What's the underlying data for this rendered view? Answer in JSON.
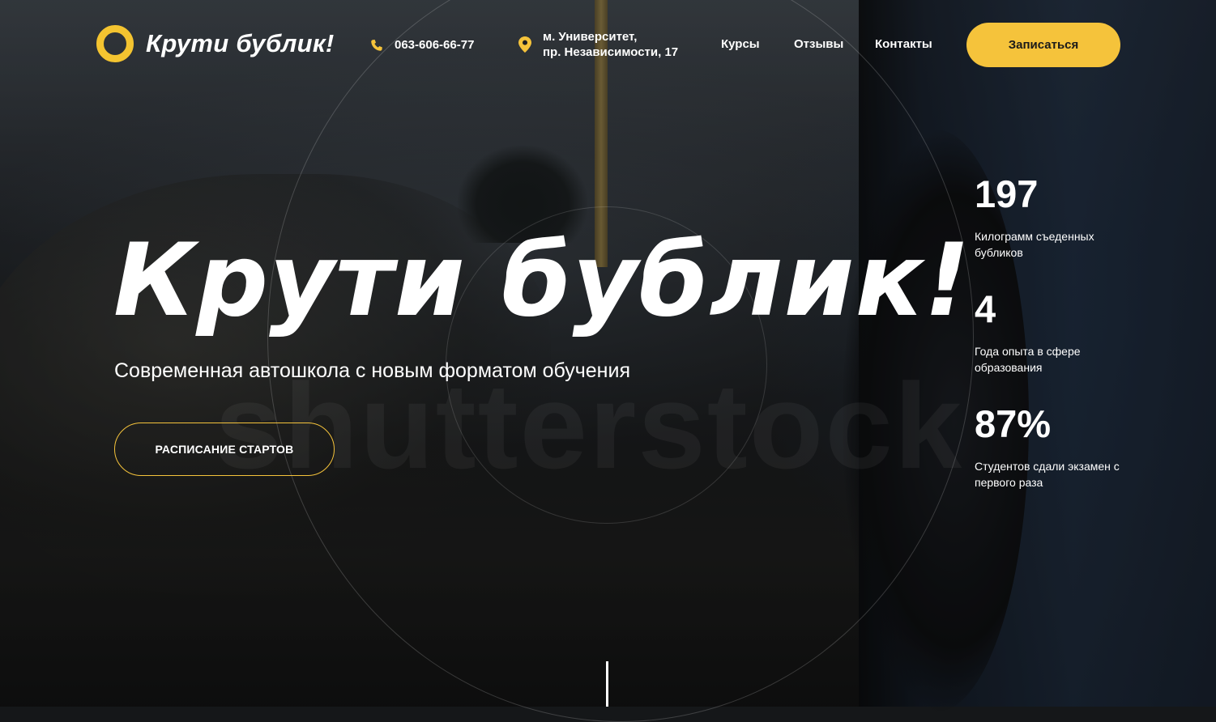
{
  "brand": {
    "name": "Крути бублик!",
    "accent_color": "#f5c33b",
    "logo_icon": "ring-icon"
  },
  "header": {
    "phone": {
      "icon": "phone-icon",
      "text": "063-606-66-77"
    },
    "address": {
      "icon": "map-pin-icon",
      "line1": "м. Университет,",
      "line2": "пр. Независимости, 17"
    },
    "nav": [
      {
        "label": "Курсы"
      },
      {
        "label": "Отзывы"
      },
      {
        "label": "Контакты"
      }
    ],
    "cta_label": "Записаться"
  },
  "hero": {
    "title": "Крути бублик!",
    "subtitle": "Современная автошкола с новым форматом обучения",
    "button_label": "РАСПИСАНИЕ СТАРТОВ",
    "watermark": "shutterstock"
  },
  "stats": [
    {
      "value": "197",
      "label": "Килограмм съеденных бубликов"
    },
    {
      "value": "4",
      "label": "Года опыта в сфере образования"
    },
    {
      "value": "87%",
      "label": "Студентов сдали экзамен с первого раза"
    }
  ]
}
